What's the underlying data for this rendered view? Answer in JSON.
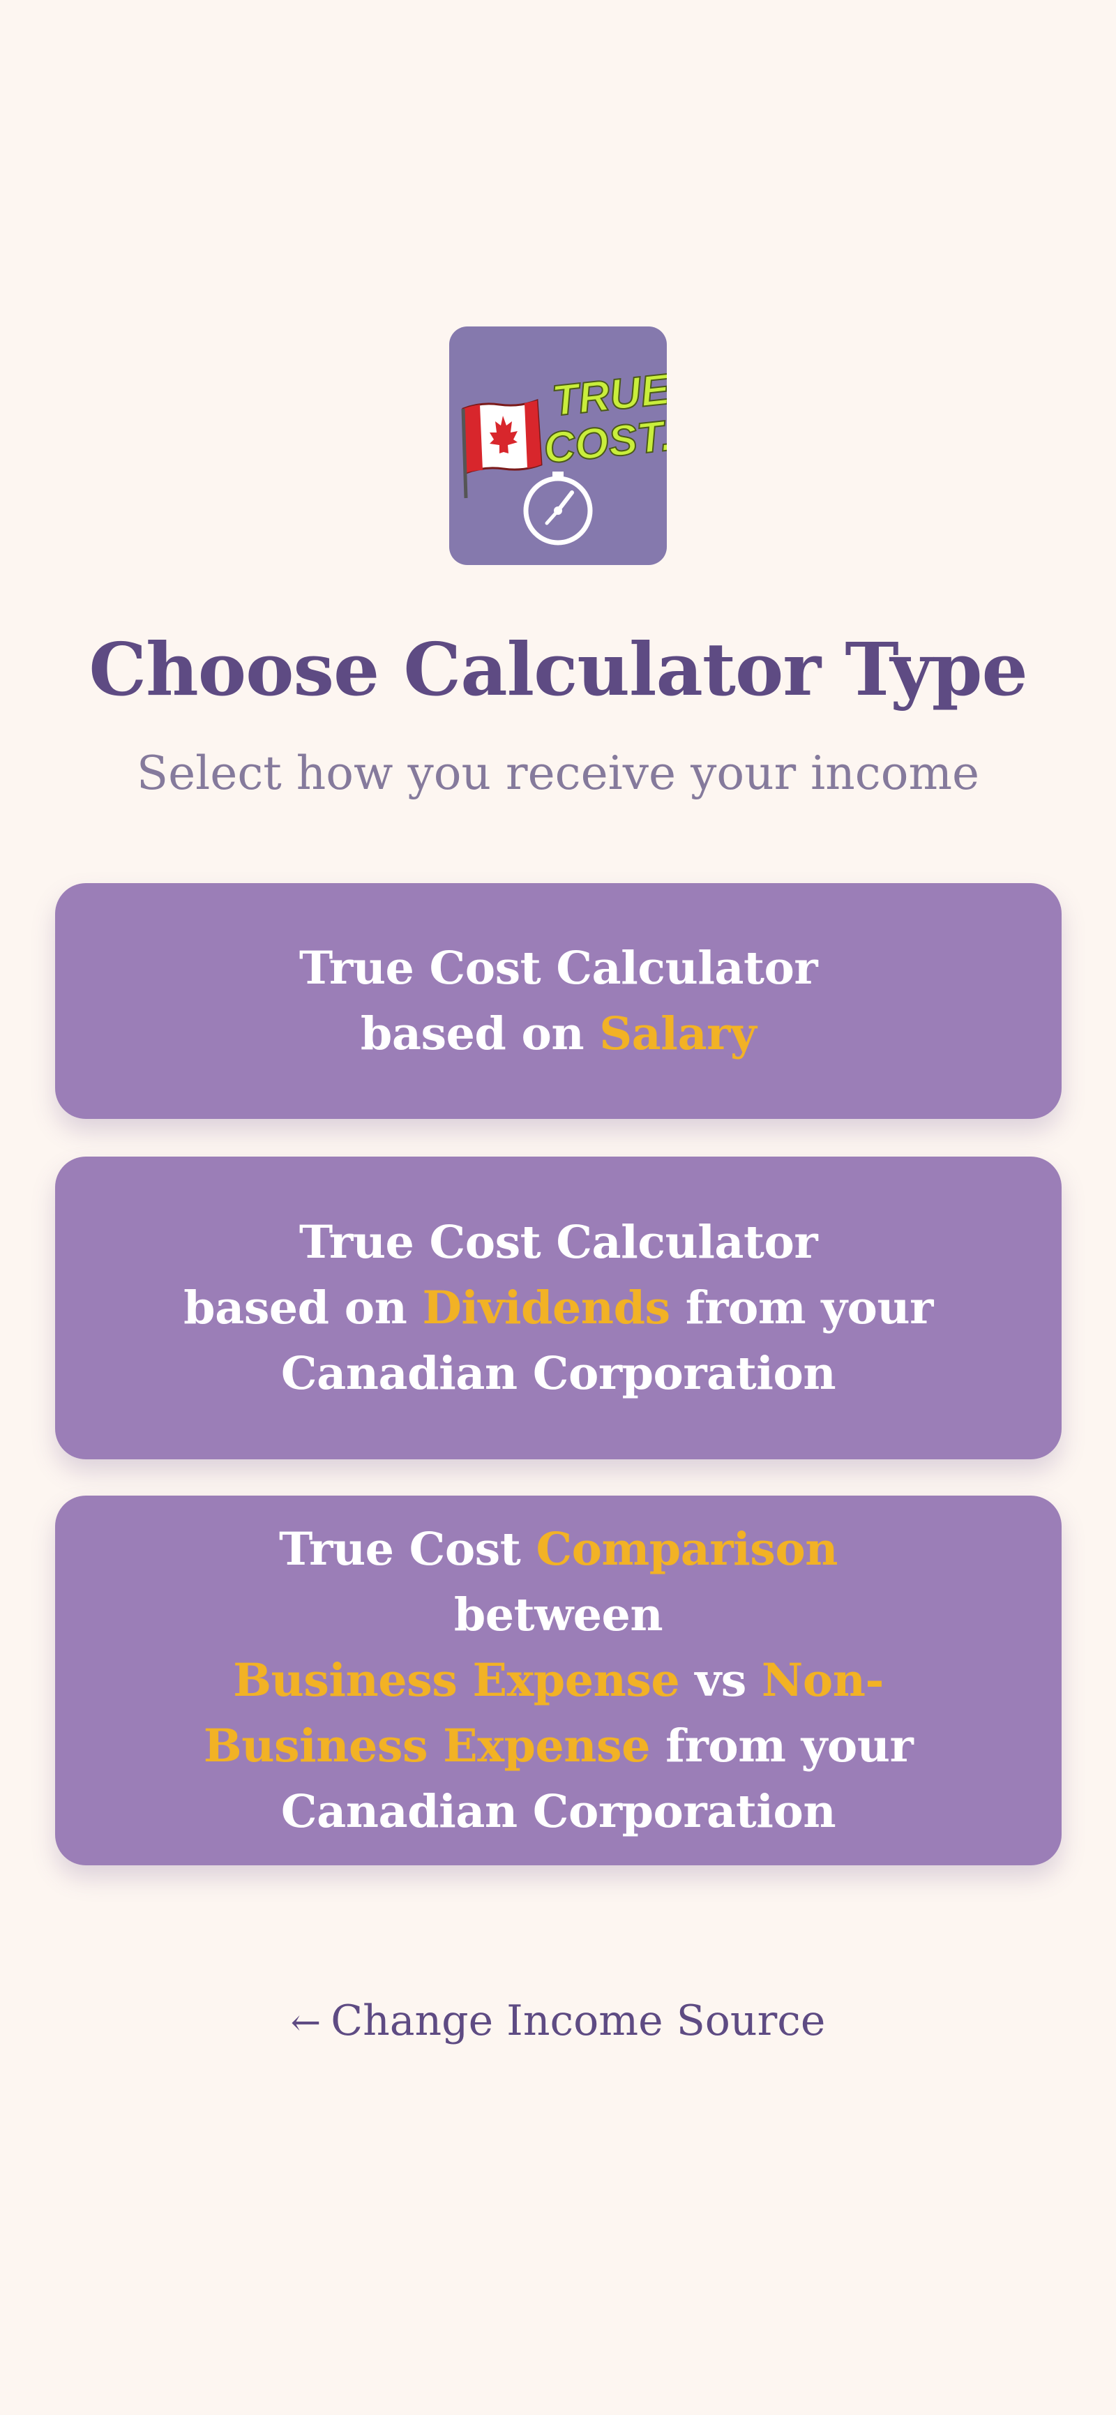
{
  "logo": {
    "line1": "TRUE",
    "line2": "COST...",
    "flag": "canada-flag-icon",
    "badge": "stopwatch-icon",
    "colors": {
      "background": "#8579ad",
      "text": "#c9ee3c",
      "flag_red": "#d8262c"
    }
  },
  "header": {
    "title": "Choose Calculator Type",
    "subtitle": "Select how you receive your income"
  },
  "options": {
    "salary": {
      "line1": "True Cost Calculator",
      "pre": "based on ",
      "highlight": "Salary"
    },
    "dividends": {
      "line1": "True Cost Calculator",
      "pre": "based on ",
      "highlight": "Dividends",
      "post": " from your",
      "line3": "Canadian Corporation"
    },
    "comparison": {
      "pre": "True Cost ",
      "highlight1": "Comparison",
      "mid1": " between",
      "highlight2": "Business Expense",
      "mid2": " vs ",
      "highlight3": "Non-Business Expense",
      "post": " from your Canadian Corporation"
    }
  },
  "footer": {
    "arrow": "←",
    "back_label": "Change Income Source"
  },
  "colors": {
    "background": "#fdf6f1",
    "card": "#9b7eb7",
    "accent": "#f2b225",
    "title": "#5e4b83"
  }
}
